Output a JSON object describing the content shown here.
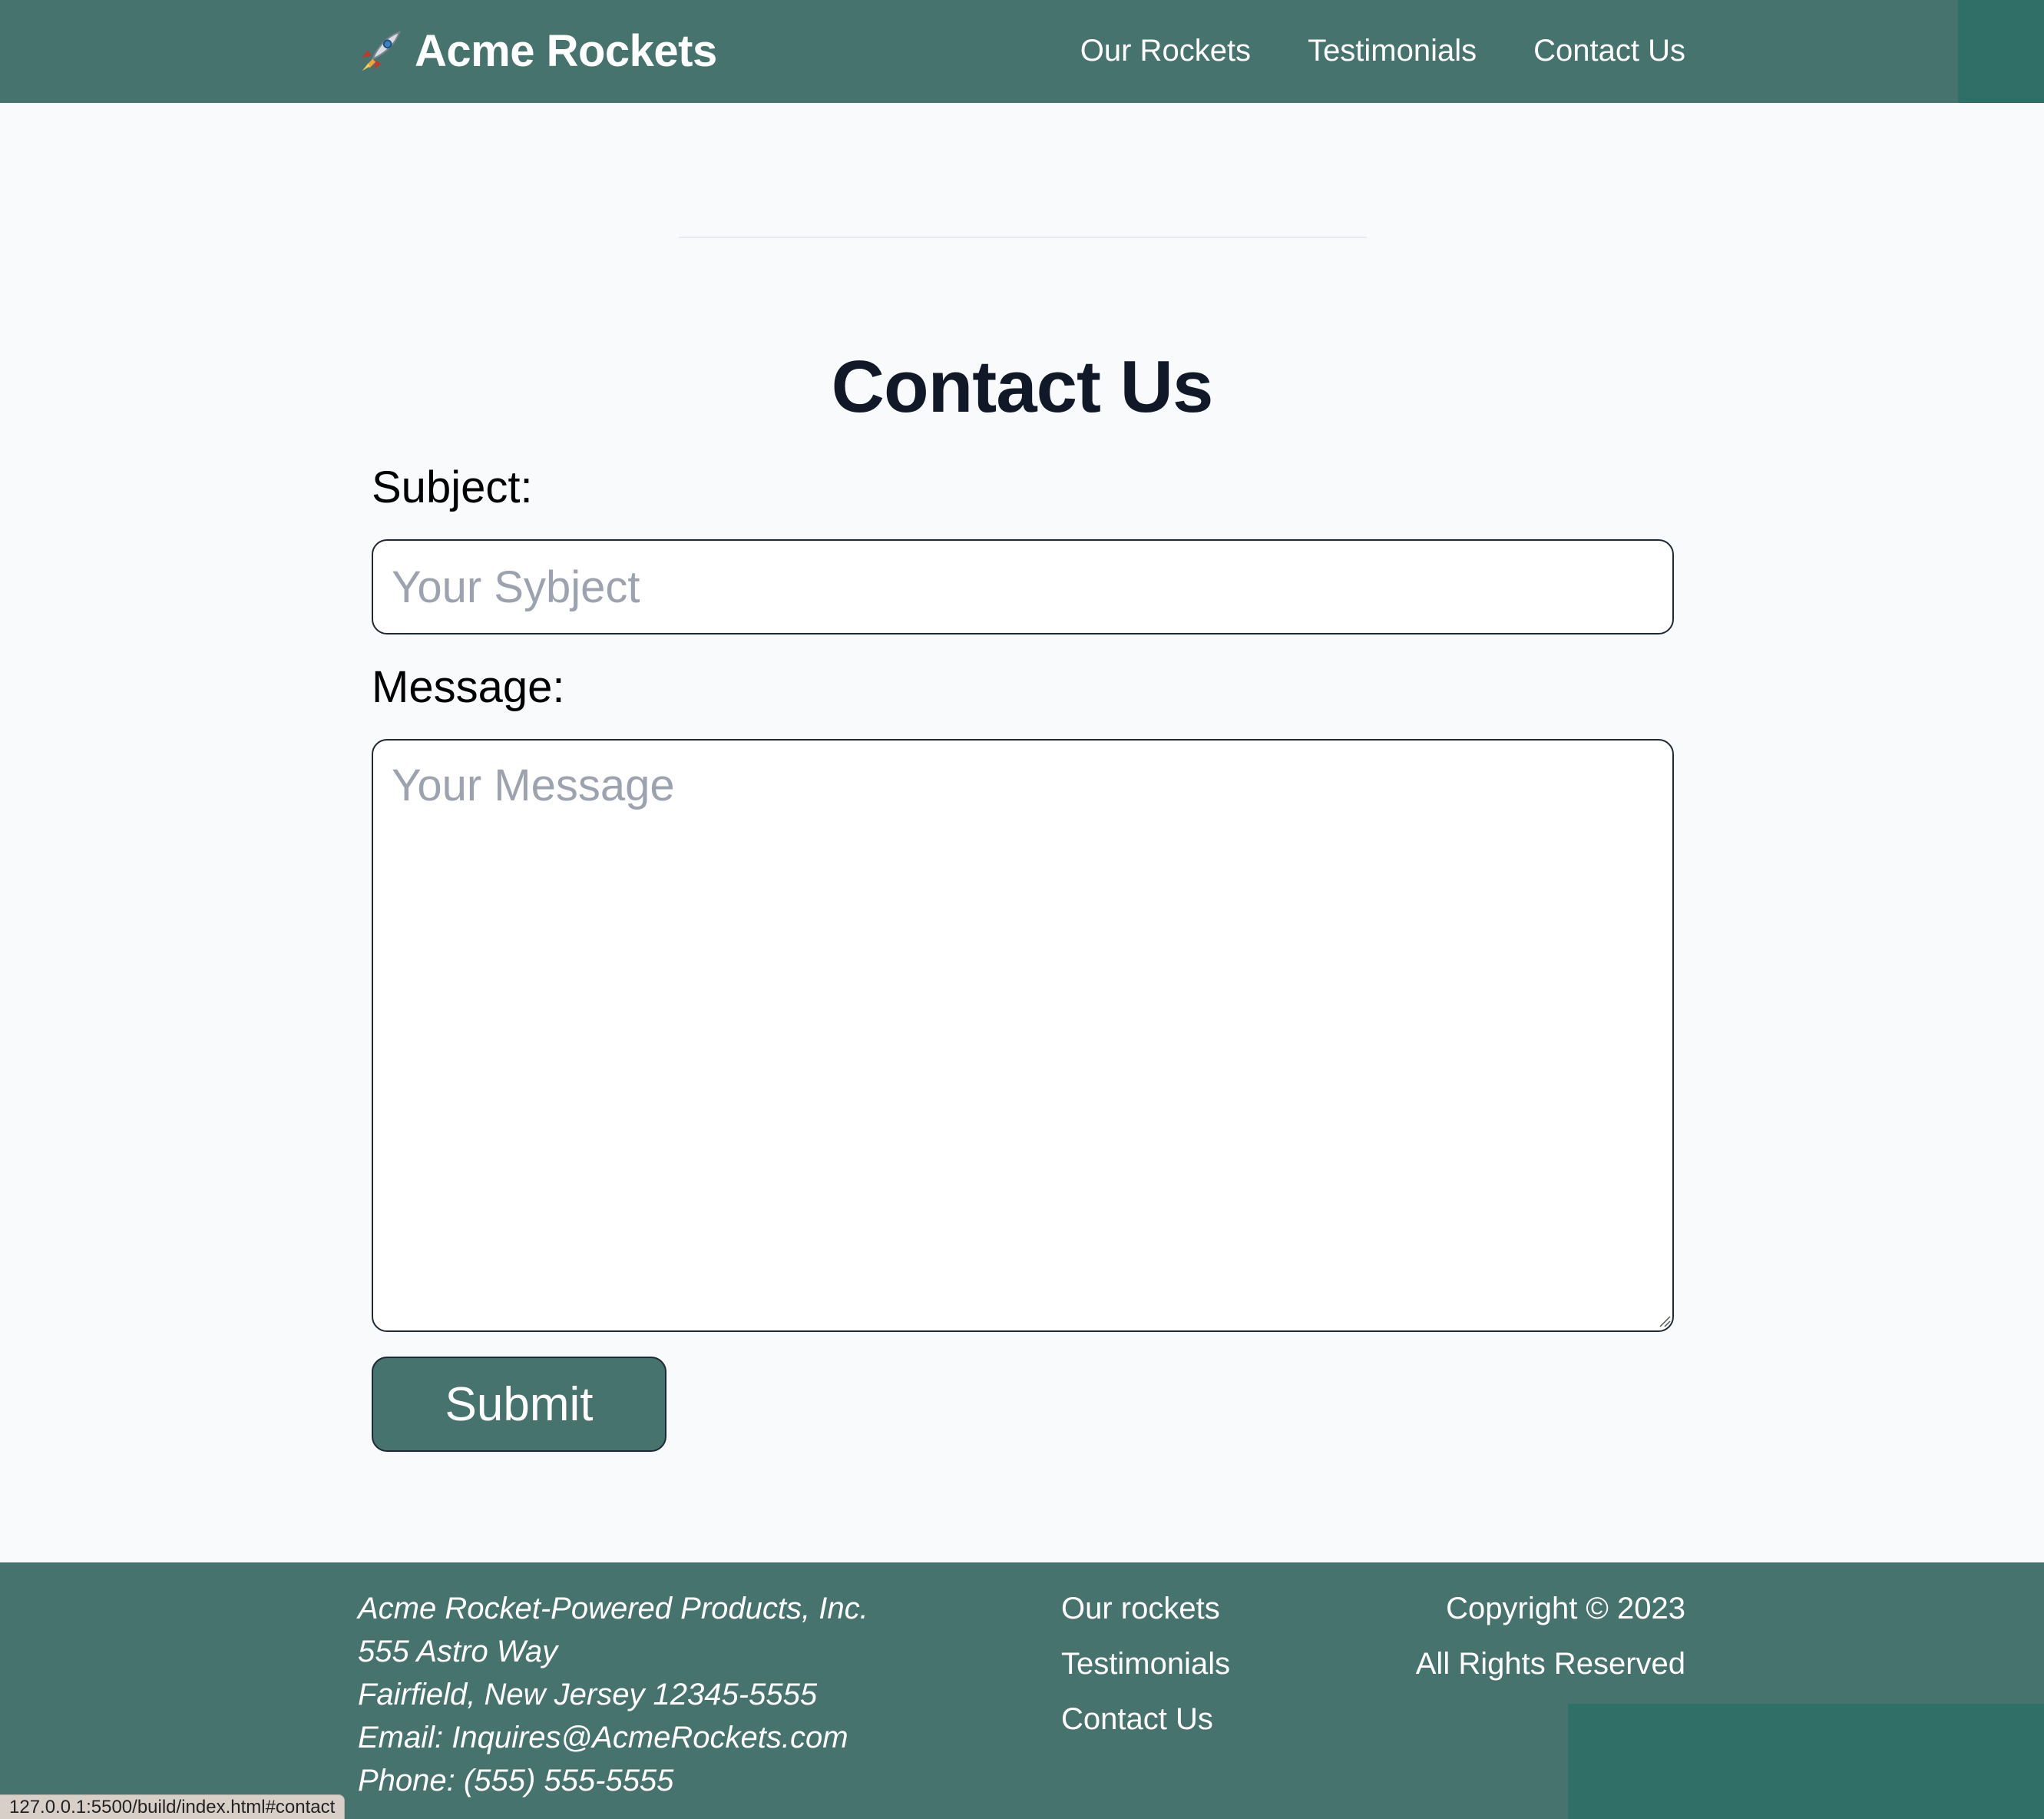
{
  "header": {
    "brand": {
      "icon": "rocket-icon",
      "name": "Acme Rockets"
    },
    "nav": [
      {
        "label": "Our Rockets"
      },
      {
        "label": "Testimonials"
      },
      {
        "label": "Contact Us"
      }
    ],
    "color": "#47736e"
  },
  "main": {
    "title": "Contact Us",
    "form": {
      "subject_label": "Subject:",
      "subject_placeholder": "Your Sybject",
      "subject_value": "",
      "message_label": "Message:",
      "message_placeholder": "Your Message",
      "message_value": "",
      "submit_label": "Submit"
    }
  },
  "footer": {
    "address": [
      "Acme Rocket-Powered Products, Inc.",
      "555 Astro Way",
      "Fairfield, New Jersey 12345-5555",
      "Email: Inquires@AcmeRockets.com",
      "Phone: (555) 555-5555"
    ],
    "links": [
      {
        "label": "Our rockets"
      },
      {
        "label": "Testimonials"
      },
      {
        "label": "Contact Us"
      }
    ],
    "copyright": "Copyright © 2023",
    "rights": "All Rights Reserved",
    "color": "#47736e"
  },
  "status_bar": {
    "url": "127.0.0.1:5500/build/index.html#contact"
  }
}
